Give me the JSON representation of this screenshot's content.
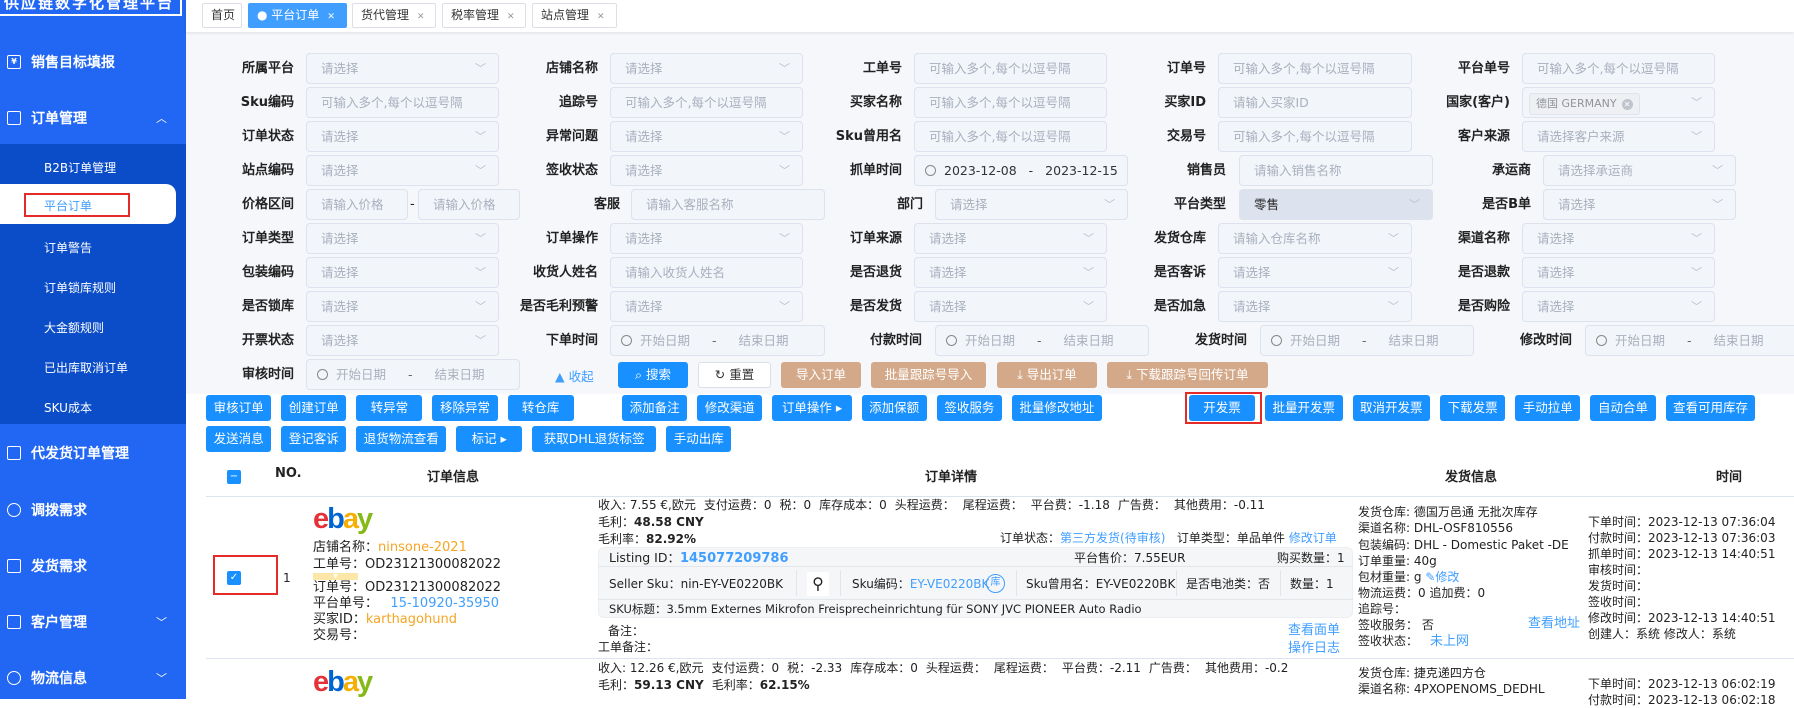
{
  "sidebar": {
    "logo": "供应链数字化管理平台",
    "items": [
      {
        "label": "销售目标填报",
        "icon": "yen-doc-icon"
      },
      {
        "label": "订单管理",
        "icon": "order-icon",
        "expanded": true
      },
      {
        "label": "代发货订单管理",
        "icon": "clipboard-icon"
      },
      {
        "label": "调拨需求",
        "icon": "transfer-icon"
      },
      {
        "label": "发货需求",
        "icon": "edit-doc-icon"
      },
      {
        "label": "客户管理",
        "icon": "customer-icon"
      },
      {
        "label": "物流信息",
        "icon": "globe-icon"
      }
    ],
    "submenu": [
      "B2B订单管理",
      "平台订单",
      "订单警告",
      "订单锁库规则",
      "大金额规则",
      "已出库取消订单",
      "SKU成本"
    ],
    "active_sub": "平台订单"
  },
  "tabs": [
    {
      "label": "首页"
    },
    {
      "label": "平台订单",
      "active": true
    },
    {
      "label": "货代管理"
    },
    {
      "label": "税率管理"
    },
    {
      "label": "站点管理"
    }
  ],
  "date_placeholder": {
    "start": "开始日期",
    "end": "结束日期",
    "sep": "-"
  },
  "filters": [
    [
      {
        "label": "所属平台",
        "type": "select",
        "ph": "请选择"
      },
      {
        "label": "店铺名称",
        "type": "select",
        "ph": "请选择"
      },
      {
        "label": "工单号",
        "type": "input",
        "ph": "可输入多个,每个以逗号隔"
      },
      {
        "label": "订单号",
        "type": "input",
        "ph": "可输入多个,每个以逗号隔"
      },
      {
        "label": "平台单号",
        "type": "input",
        "ph": "可输入多个,每个以逗号隔"
      }
    ],
    [
      {
        "label": "Sku编码",
        "type": "input",
        "ph": "可输入多个,每个以逗号隔"
      },
      {
        "label": "追踪号",
        "type": "input",
        "ph": "可输入多个,每个以逗号隔"
      },
      {
        "label": "买家名称",
        "type": "input",
        "ph": "可输入多个,每个以逗号隔"
      },
      {
        "label": "买家ID",
        "type": "input",
        "ph": "请输入买家ID"
      },
      {
        "label": "国家(客户)",
        "type": "tag",
        "value": "德国 GERMANY"
      }
    ],
    [
      {
        "label": "订单状态",
        "type": "select",
        "ph": "请选择"
      },
      {
        "label": "异常问题",
        "type": "select",
        "ph": "请选择"
      },
      {
        "label": "Sku曾用名",
        "type": "input",
        "ph": "可输入多个,每个以逗号隔"
      },
      {
        "label": "交易号",
        "type": "input",
        "ph": "可输入多个,每个以逗号隔"
      },
      {
        "label": "客户来源",
        "type": "select",
        "ph": "请选择客户来源"
      }
    ],
    [
      {
        "label": "站点编码",
        "type": "select",
        "ph": "请选择"
      },
      {
        "label": "签收状态",
        "type": "select",
        "ph": "请选择"
      },
      {
        "label": "抓单时间",
        "type": "date",
        "start": "2023-12-08",
        "end": "2023-12-15"
      },
      {
        "label": "销售员",
        "type": "input",
        "ph": "请输入销售名称"
      },
      {
        "label": "承运商",
        "type": "select",
        "ph": "请选择承运商"
      }
    ],
    [
      {
        "label": "价格区间",
        "type": "range",
        "ph": "请输入价格",
        "ph2": "请输入价格"
      },
      {
        "label": "客服",
        "type": "input",
        "ph": "请输入客服名称"
      },
      {
        "label": "部门",
        "type": "select",
        "ph": "请选择"
      },
      {
        "label": "平台类型",
        "type": "filled",
        "value": "零售"
      },
      {
        "label": "是否B单",
        "type": "select",
        "ph": "请选择"
      }
    ],
    [
      {
        "label": "订单类型",
        "type": "select",
        "ph": "请选择"
      },
      {
        "label": "订单操作",
        "type": "select",
        "ph": "请选择"
      },
      {
        "label": "订单来源",
        "type": "select",
        "ph": "请选择"
      },
      {
        "label": "发货仓库",
        "type": "select",
        "ph": "请输入仓库名称"
      },
      {
        "label": "渠道名称",
        "type": "select",
        "ph": "请选择"
      }
    ],
    [
      {
        "label": "包装编码",
        "type": "select",
        "ph": "请选择"
      },
      {
        "label": "收货人姓名",
        "type": "input",
        "ph": "请输入收货人姓名"
      },
      {
        "label": "是否退货",
        "type": "select",
        "ph": "请选择"
      },
      {
        "label": "是否客诉",
        "type": "select",
        "ph": "请选择"
      },
      {
        "label": "是否退款",
        "type": "select",
        "ph": "请选择"
      }
    ],
    [
      {
        "label": "是否锁库",
        "type": "select",
        "ph": "请选择"
      },
      {
        "label": "是否毛利预警",
        "type": "select",
        "ph": "请选择"
      },
      {
        "label": "是否发货",
        "type": "select",
        "ph": "请选择"
      },
      {
        "label": "是否加急",
        "type": "select",
        "ph": "请选择"
      },
      {
        "label": "是否购险",
        "type": "select",
        "ph": "请选择"
      }
    ],
    [
      {
        "label": "开票状态",
        "type": "select",
        "ph": "请选择"
      },
      {
        "label": "下单时间",
        "type": "date"
      },
      {
        "label": "付款时间",
        "type": "date"
      },
      {
        "label": "发货时间",
        "type": "date"
      },
      {
        "label": "修改时间",
        "type": "date"
      }
    ],
    [
      {
        "label": "审核时间",
        "type": "date"
      }
    ]
  ],
  "actions": {
    "collapse": "▲ 收起",
    "search": "搜索",
    "reset": "重置",
    "import_orders": "导入订单",
    "batch_tracking_import": "批量跟踪号导入",
    "export_orders": "导出订单",
    "download_tracking": "下载跟踪号回传订单"
  },
  "toolbar": {
    "row1": [
      "审核订单",
      "创建订单",
      "转异常",
      "移除异常",
      "转仓库",
      "添加备注",
      "修改渠道",
      "订单操作 ▸",
      "添加保额",
      "签收服务",
      "批量修改地址",
      "开发票",
      "批量开发票",
      "取消开发票",
      "下载发票",
      "手动拉单",
      "自动合单",
      "查看可用库存"
    ],
    "row2": [
      "发送消息",
      "登记客诉",
      "退货物流查看",
      "标记 ▸",
      "获取DHL退货标签",
      "手动出库"
    ],
    "highlighted": "开发票"
  },
  "table": {
    "headers": {
      "no": "NO.",
      "order_info": "订单信息",
      "order_detail": "订单详情",
      "shipping": "发货信息",
      "time": "时间"
    },
    "rows": [
      {
        "no": "1",
        "checked": true,
        "platform_logo": "ebay",
        "shop_label": "店铺名称：",
        "shop": "ninsone-2021",
        "ticket_label": "工单号：",
        "ticket": "OD23121300082022",
        "order_label": "订单号：",
        "order": "OD23121300082022",
        "platform_no_label": "平台单号：",
        "platform_no": "15-10920-35950",
        "buyer_label": "买家ID：",
        "buyer": "karthagohund",
        "trade_label": "交易号：",
        "fees": [
          "收入: 7.55 €,欧元",
          "支付运费：0",
          "税：0",
          "库存成本：0",
          "头程运费：",
          "尾程运费：",
          "平台费：-1.18",
          "广告费：",
          "其他费用：-0.11"
        ],
        "profit_label": "毛利：",
        "profit": "48.58 CNY",
        "margin_label": "毛利率：",
        "margin": "82.92%",
        "status_label": "订单状态：",
        "status": "第三方发货(待审核)",
        "type_label": "订单类型：",
        "type": "单品单件",
        "edit_order": "修改订单",
        "listing_label": "Listing ID：",
        "listing": "145077209786",
        "price_label": "平台售价：7.55EUR",
        "buy_qty": "购买数量：1",
        "seller_sku": "Seller Sku：nin-EY-VE0220BK",
        "sku_label": "Sku编码：",
        "sku": "EY-VE0220BK",
        "stock_badge": "库",
        "sku_alias": "Sku曾用名：EY-VE0220BK",
        "battery": "是否电池类：否",
        "qty": "数量：1",
        "sku_title": "SKU标题：3.5mm Externes Mikrofon Freisprecheinrichtung für SONY JVC PIONEER Auto Radio",
        "remark": "备注：",
        "ticket_remark": "工单备注：",
        "view_label": "查看面单",
        "op_log": "操作日志",
        "ship": {
          "warehouse": "发货仓库: 德国万邑通 无批次库存",
          "channel": "渠道名称: DHL-OSF810556",
          "package": "包装编码: DHL - Domestic Paket -DE",
          "weight": "订单重量: 40g",
          "pack_weight": "包材重量: g",
          "edit": "修改",
          "freight": "物流运费：0   追加费：0",
          "tracking": "追踪号：",
          "sign_service": "签收服务：  否",
          "view_address": "查看地址",
          "sign_status_label": "签收状态：",
          "sign_status": "未上网"
        },
        "times": [
          "下单时间：2023-12-13 07:36:04",
          "付款时间：2023-12-13 07:36:03",
          "抓单时间：2023-12-13 14:40:51",
          "审核时间：",
          "发货时间：",
          "签收时间：",
          "修改时间：2023-12-13 14:40:51",
          "创建人：系统   修改人：系统"
        ]
      },
      {
        "platform_logo": "ebay",
        "fees": [
          "收入: 12.26 €,欧元",
          "支付运费：0",
          "税：-2.33",
          "库存成本：0",
          "头程运费：",
          "尾程运费：",
          "平台费：-2.11",
          "广告费：",
          "其他费用：-0.2"
        ],
        "profit_label": "毛利：",
        "profit": "59.13 CNY",
        "margin_label": "毛利率：",
        "margin": "62.15%",
        "ship": {
          "warehouse": "发货仓库: 捷克递四方仓",
          "channel": "渠道名称: 4PXOPENOMS_DEDHL"
        },
        "times": [
          "下单时间：2023-12-13 06:02:19",
          "付款时间：2023-12-13 06:02:18"
        ]
      }
    ]
  }
}
